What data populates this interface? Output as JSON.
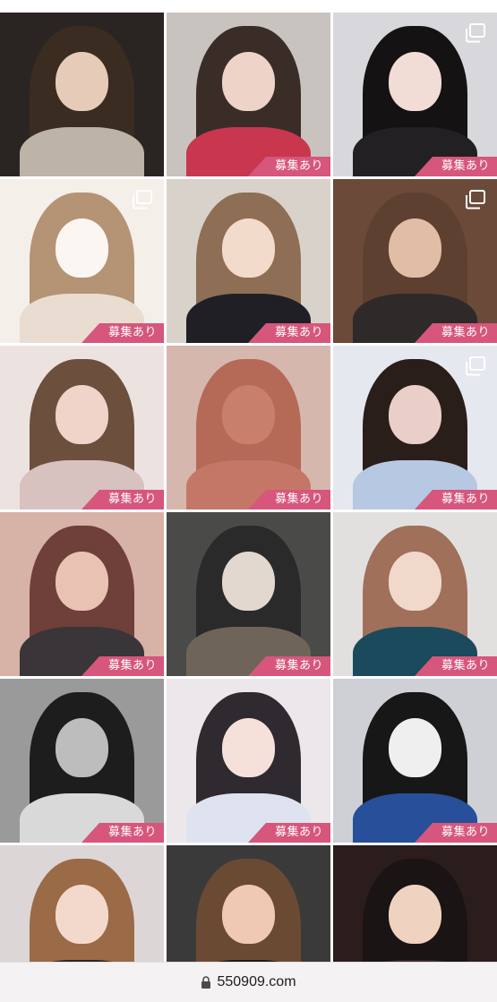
{
  "grid": {
    "badge_label": "募集あり",
    "tiles": [
      {
        "badge": "",
        "multi": false,
        "bg": "#2a2522",
        "hair": "#3b2c22",
        "face": "#e6cbb8",
        "body": "#bdb3a6"
      },
      {
        "badge": "募集あり",
        "multi": false,
        "bg": "#c9c3c0",
        "hair": "#3a2d27",
        "face": "#eed3c8",
        "body": "#c8374e"
      },
      {
        "badge": "募集あり",
        "multi": true,
        "bg": "#d8d8dc",
        "hair": "#151214",
        "face": "#f1dcd6",
        "body": "#222022"
      },
      {
        "badge": "募集あり",
        "multi": true,
        "bg": "#f4efe9",
        "hair": "#b59375",
        "face": "#fbf6f2",
        "body": "#e9ddd2"
      },
      {
        "badge": "募集あり",
        "multi": false,
        "bg": "#d9d2cb",
        "hair": "#8e6f55",
        "face": "#f3dbcc",
        "body": "#1f1f25"
      },
      {
        "badge": "募集あり",
        "multi": true,
        "bg": "#6b4a3a",
        "hair": "#5e4030",
        "face": "#e2bda6",
        "body": "#2e2a29"
      },
      {
        "badge": "募集あり",
        "multi": false,
        "bg": "#ece3e1",
        "hair": "#6d4f3d",
        "face": "#f1d4c9",
        "body": "#d7c2c0"
      },
      {
        "badge": "募集あり",
        "multi": false,
        "bg": "#d6b7ae",
        "hair": "#b46a56",
        "face": "#c8806c",
        "body": "#c57767"
      },
      {
        "badge": "募集あり",
        "multi": true,
        "bg": "#e5e8ee",
        "hair": "#2a1e1a",
        "face": "#e9cfc8",
        "body": "#b6c8e2"
      },
      {
        "badge": "募集あり",
        "multi": false,
        "bg": "#d7b2a7",
        "hair": "#6f3f3a",
        "face": "#e9c2b4",
        "body": "#3a3538"
      },
      {
        "badge": "募集あり",
        "multi": false,
        "bg": "#4a4a48",
        "hair": "#2a2a2a",
        "face": "#e2d8cf",
        "body": "#6e6558"
      },
      {
        "badge": "募集あり",
        "multi": false,
        "bg": "#e2e0de",
        "hair": "#a0705a",
        "face": "#f0d8cb",
        "body": "#1b4a5c"
      },
      {
        "badge": "募集あり",
        "multi": false,
        "bg": "#9a9a9a",
        "hair": "#1d1d1d",
        "face": "#bdbdbd",
        "body": "#d9d9d9"
      },
      {
        "badge": "募集あり",
        "multi": false,
        "bg": "#ebe7ea",
        "hair": "#2e2a30",
        "face": "#f6e1da",
        "body": "#dfe3ef"
      },
      {
        "badge": "募集あり",
        "multi": false,
        "bg": "#cfd0d6",
        "hair": "#171717",
        "face": "#efefef",
        "body": "#274f9a"
      },
      {
        "badge": "",
        "multi": false,
        "bg": "#dcd6d6",
        "hair": "#9b6a47",
        "face": "#f3d9cb",
        "body": "#2a2626"
      },
      {
        "badge": "",
        "multi": false,
        "bg": "#3a3a3a",
        "hair": "#6b4a34",
        "face": "#efc9b1",
        "body": "#1a1a1a"
      },
      {
        "badge": "",
        "multi": false,
        "bg": "#2b1d1c",
        "hair": "#1a1414",
        "face": "#efd2c0",
        "body": "#3a2a2a"
      }
    ]
  },
  "url_bar": {
    "domain": "550909.com",
    "lock_icon": "lock-icon"
  }
}
